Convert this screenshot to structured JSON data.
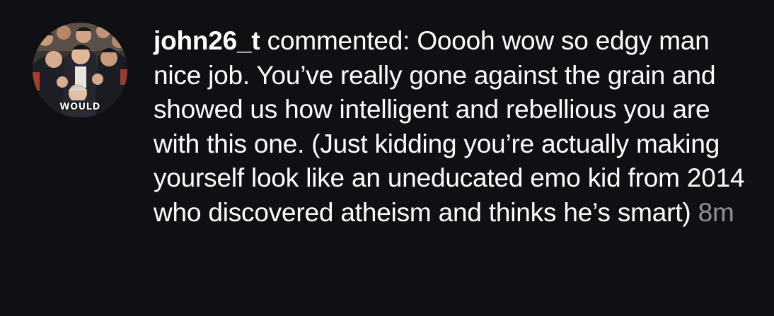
{
  "comment": {
    "username": "john26_t",
    "action": "commented:",
    "text": "Ooooh wow so edgy man nice job. You’ve really gone against the grain and showed us how intelligent and rebellious you are with this one. (Just kidding you’re actually making yourself look like an uneducated emo kid from 2014 who discovered atheism and thinks he’s smart)",
    "time": "8m"
  },
  "avatar": {
    "caption": "WOULD"
  },
  "colors": {
    "background": "#0f1014",
    "text": "#ffffff",
    "timestamp": "#8e9096"
  }
}
